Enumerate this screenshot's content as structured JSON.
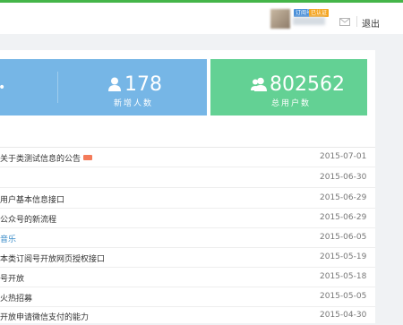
{
  "header": {
    "account_type_badge": "订阅号",
    "verified_badge": "已认证",
    "logout_label": "退出",
    "icons": [
      "mail-icon"
    ]
  },
  "stats": {
    "new_users": {
      "value": "178",
      "label": "新增人数",
      "icon": "user-icon"
    },
    "total_users": {
      "value": "802562",
      "label": "总用户数",
      "icon": "users-icon"
    }
  },
  "notices": [
    {
      "title": "关于类测试信息的公告",
      "date": "2015-07-01",
      "is_new": true,
      "link": false
    },
    {
      "title": "",
      "date": "2015-06-30",
      "is_new": false,
      "link": false
    },
    {
      "title": "用户基本信息接口",
      "date": "2015-06-29",
      "is_new": false,
      "link": false
    },
    {
      "title": "公众号的新流程",
      "date": "2015-06-29",
      "is_new": false,
      "link": false
    },
    {
      "title": "音乐",
      "date": "2015-06-05",
      "is_new": false,
      "link": true
    },
    {
      "title": "本类订阅号开放网页授权接口",
      "date": "2015-05-19",
      "is_new": false,
      "link": false
    },
    {
      "title": "号开放",
      "date": "2015-05-18",
      "is_new": false,
      "link": false
    },
    {
      "title": "火热招募",
      "date": "2015-05-05",
      "is_new": false,
      "link": false
    },
    {
      "title": "开放申请微信支付的能力",
      "date": "2015-04-30",
      "is_new": false,
      "link": false
    }
  ],
  "colors": {
    "brand_green": "#44b549",
    "stat_blue": "#76b6e6",
    "stat_green": "#63d194",
    "link_blue": "#3c8dc9",
    "new_tag": "#f47b5a"
  }
}
